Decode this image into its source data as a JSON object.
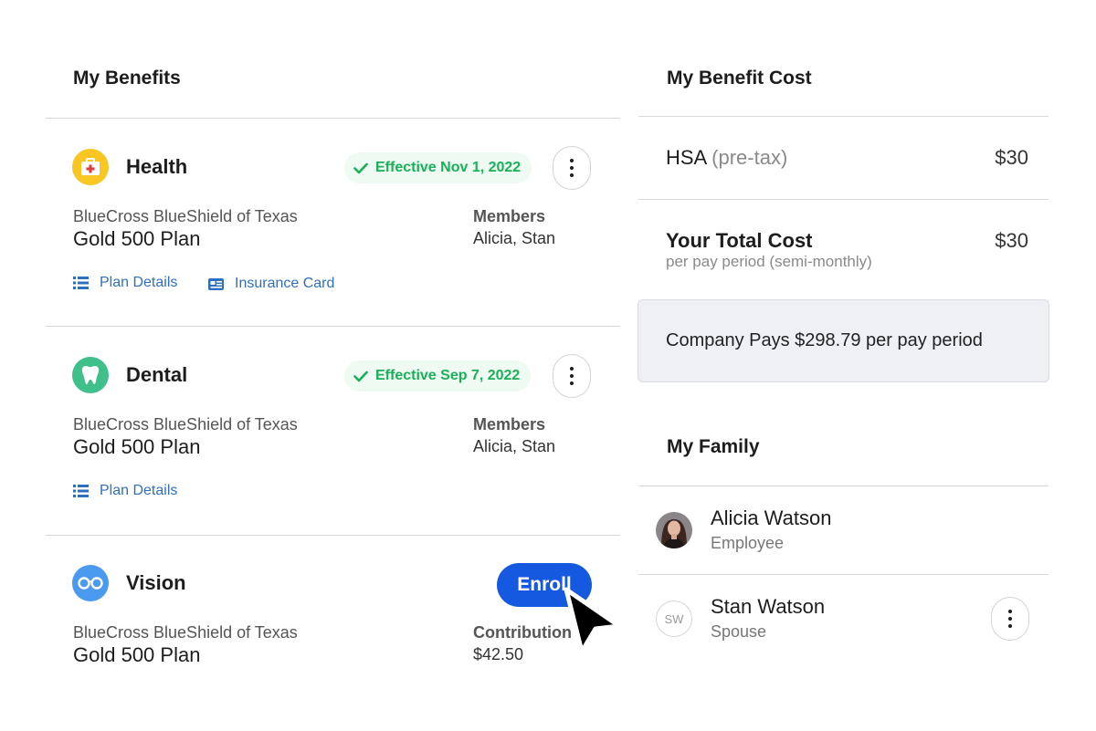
{
  "benefits": {
    "title": "My Benefits",
    "items": [
      {
        "name": "Health",
        "icon": "medical-kit-icon",
        "badge": "Effective Nov 1, 2022",
        "carrier": "BlueCross BlueShield of Texas",
        "plan": "Gold 500 Plan",
        "meta_label": "Members",
        "meta_value": "Alicia, Stan",
        "links": [
          "Plan Details",
          "Insurance Card"
        ]
      },
      {
        "name": "Dental",
        "icon": "tooth-icon",
        "badge": "Effective Sep 7, 2022",
        "carrier": "BlueCross BlueShield of Texas",
        "plan": "Gold 500 Plan",
        "meta_label": "Members",
        "meta_value": "Alicia, Stan",
        "links": [
          "Plan Details"
        ]
      },
      {
        "name": "Vision",
        "icon": "glasses-icon",
        "action": "Enroll",
        "carrier": "BlueCross BlueShield of Texas",
        "plan": "Gold 500 Plan",
        "meta_label": "Contribution",
        "meta_value": "$42.50"
      }
    ]
  },
  "cost": {
    "title": "My Benefit Cost",
    "hsa_label": "HSA",
    "hsa_qualifier": "(pre-tax)",
    "hsa_value": "$30",
    "total_label": "Your Total Cost",
    "total_sub": "per pay period (semi-monthly)",
    "total_value": "$30",
    "company_pays": "Company Pays $298.79 per pay period"
  },
  "family": {
    "title": "My Family",
    "members": [
      {
        "name": "Alicia Watson",
        "role": "Employee",
        "avatar": "photo"
      },
      {
        "name": "Stan Watson",
        "role": "Spouse",
        "initials": "SW"
      }
    ]
  },
  "colors": {
    "accent_blue": "#1559e0",
    "link_blue": "#2f6fc2",
    "success_green": "#19b05a",
    "health_icon_bg": "#f9c623",
    "dental_icon_bg": "#3fbf8a",
    "vision_icon_bg": "#4a9af0"
  }
}
